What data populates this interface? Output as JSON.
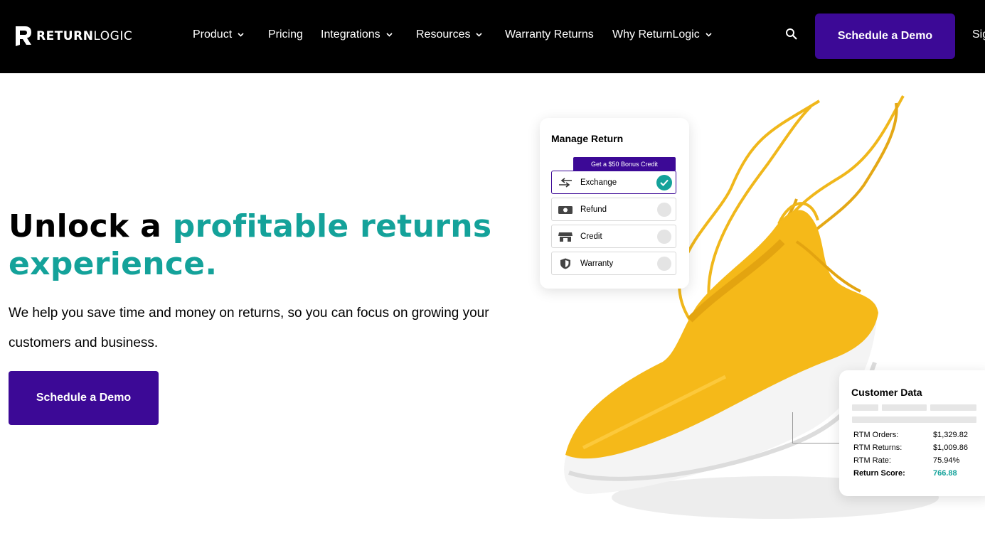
{
  "nav": {
    "logo_bold": "RETURN",
    "logo_light": "LOGIC",
    "items": [
      {
        "label": "Product",
        "has_dropdown": true
      },
      {
        "label": "Pricing",
        "has_dropdown": false
      },
      {
        "label": "Integrations",
        "has_dropdown": true
      },
      {
        "label": "Resources",
        "has_dropdown": true
      },
      {
        "label": "Warranty Returns",
        "has_dropdown": false
      },
      {
        "label": "Why ReturnLogic",
        "has_dropdown": true
      }
    ],
    "cta_label": "Schedule a Demo",
    "sign_in_label": "Sig"
  },
  "hero": {
    "headline_dark": "Unlock a ",
    "headline_teal": "profitable returns experience.",
    "subtext": "We help you save time and money on returns, so you can focus on growing your customers and business.",
    "cta_label": "Schedule a Demo"
  },
  "manage_return": {
    "title": "Manage Return",
    "badge": "Get a $50 Bonus Credit",
    "options": [
      {
        "label": "Exchange",
        "selected": true,
        "icon": "exchange-arrows-icon"
      },
      {
        "label": "Refund",
        "selected": false,
        "icon": "money-bill-icon"
      },
      {
        "label": "Credit",
        "selected": false,
        "icon": "store-icon"
      },
      {
        "label": "Warranty",
        "selected": false,
        "icon": "shield-icon"
      }
    ]
  },
  "customer_data": {
    "title": "Customer Data",
    "rows": [
      {
        "label": "RTM Orders:",
        "value": "$1,329.82"
      },
      {
        "label": "RTM Returns:",
        "value": "$1,009.86"
      },
      {
        "label": "RTM Rate:",
        "value": "75.94%"
      },
      {
        "label": "Return Score:",
        "value": "766.88"
      }
    ]
  },
  "colors": {
    "brand_purple": "#3c0996",
    "teal": "#14a29a",
    "nav_bg": "#000000",
    "shoe_yellow": "#f5b919"
  }
}
